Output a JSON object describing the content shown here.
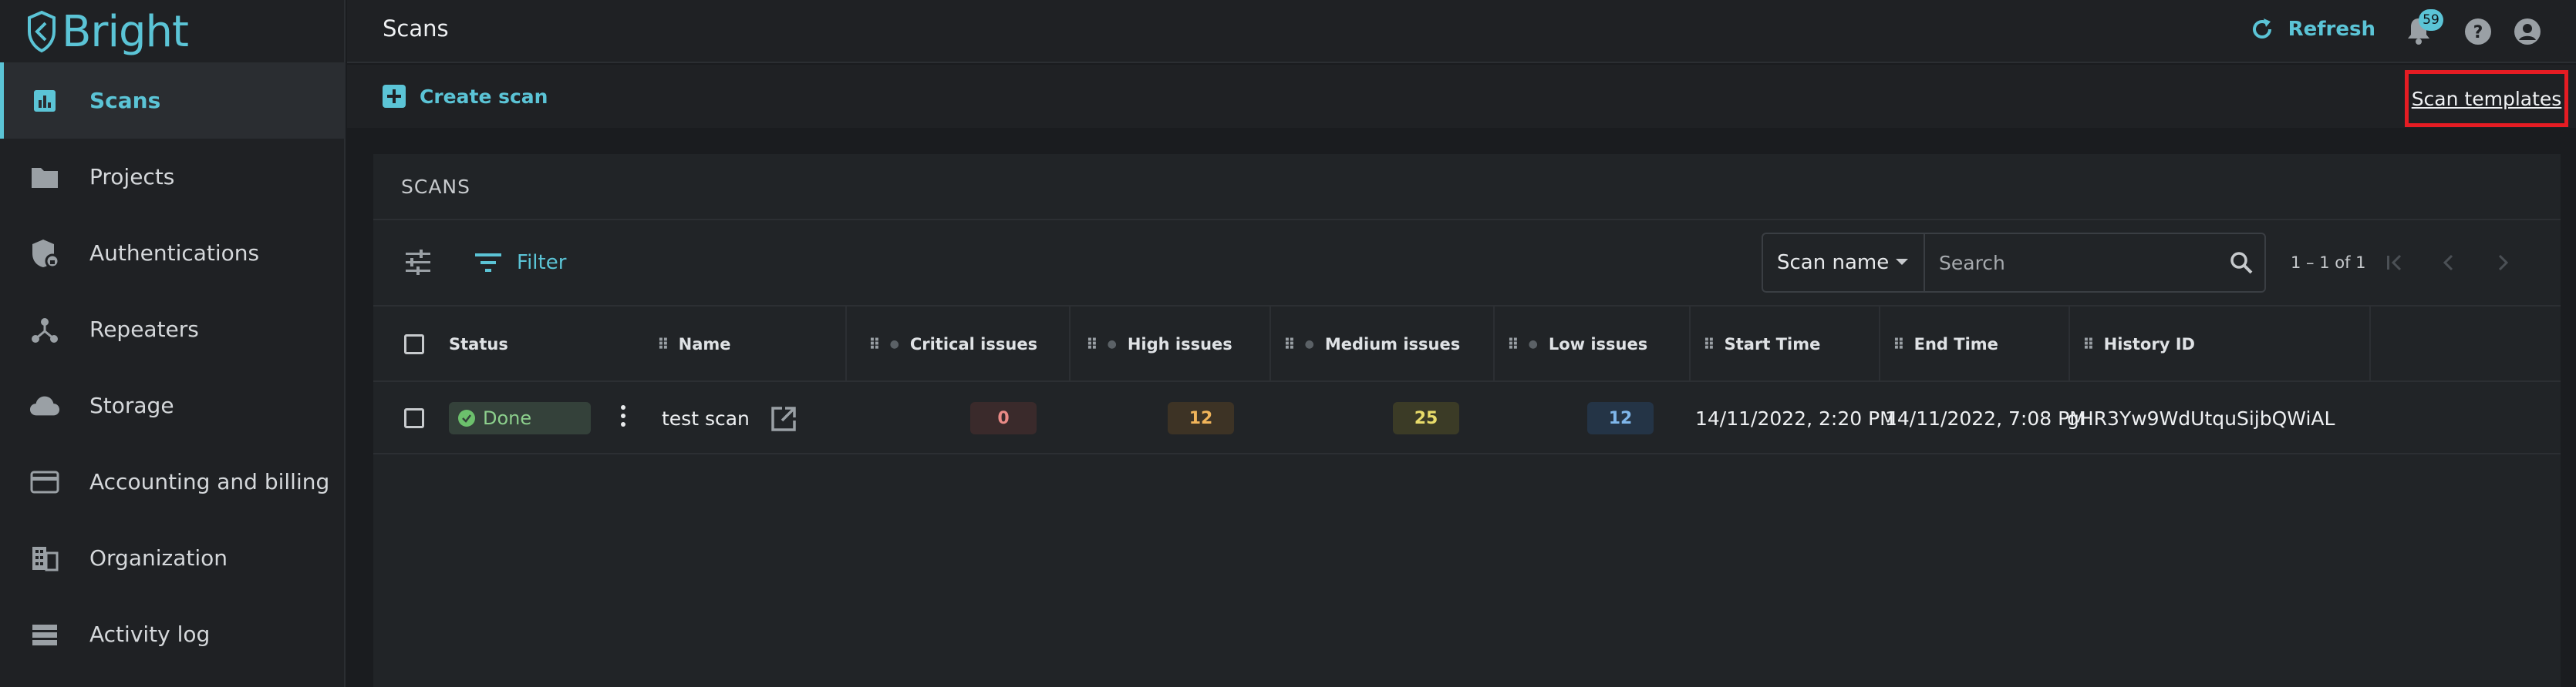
{
  "app": {
    "logo_text": "Bright"
  },
  "sidebar": {
    "items": [
      {
        "label": "Scans",
        "icon": "chart-icon",
        "active": true
      },
      {
        "label": "Projects",
        "icon": "folder-icon"
      },
      {
        "label": "Authentications",
        "icon": "shield-lock-icon"
      },
      {
        "label": "Repeaters",
        "icon": "hub-icon"
      },
      {
        "label": "Storage",
        "icon": "cloud-icon"
      },
      {
        "label": "Accounting and billing",
        "icon": "credit-card-icon"
      },
      {
        "label": "Organization",
        "icon": "building-icon"
      },
      {
        "label": "Activity log",
        "icon": "list-icon"
      }
    ]
  },
  "header": {
    "title": "Scans",
    "refresh_label": "Refresh",
    "notification_count": "59"
  },
  "actions": {
    "create_scan": "Create scan",
    "scan_templates": "Scan templates"
  },
  "card": {
    "title": "SCANS",
    "filter_label": "Filter",
    "search": {
      "selected_field": "Scan name",
      "placeholder": "Search"
    },
    "pagination": "1 – 1 of 1"
  },
  "table": {
    "columns": [
      "Status",
      "Name",
      "Critical issues",
      "High issues",
      "Medium issues",
      "Low issues",
      "Start Time",
      "End Time",
      "History ID"
    ],
    "rows": [
      {
        "status": "Done",
        "name": "test scan",
        "critical": "0",
        "high": "12",
        "medium": "25",
        "low": "12",
        "start_time": "14/11/2022, 2:20 PM",
        "end_time": "14/11/2022, 7:08 PM",
        "history_id": "gHR3Yw9WdUtquSijbQWiAL"
      }
    ]
  },
  "colors": {
    "accent": "#5bc4d6",
    "highlight": "#e51c23",
    "done": "#6cc06c"
  }
}
